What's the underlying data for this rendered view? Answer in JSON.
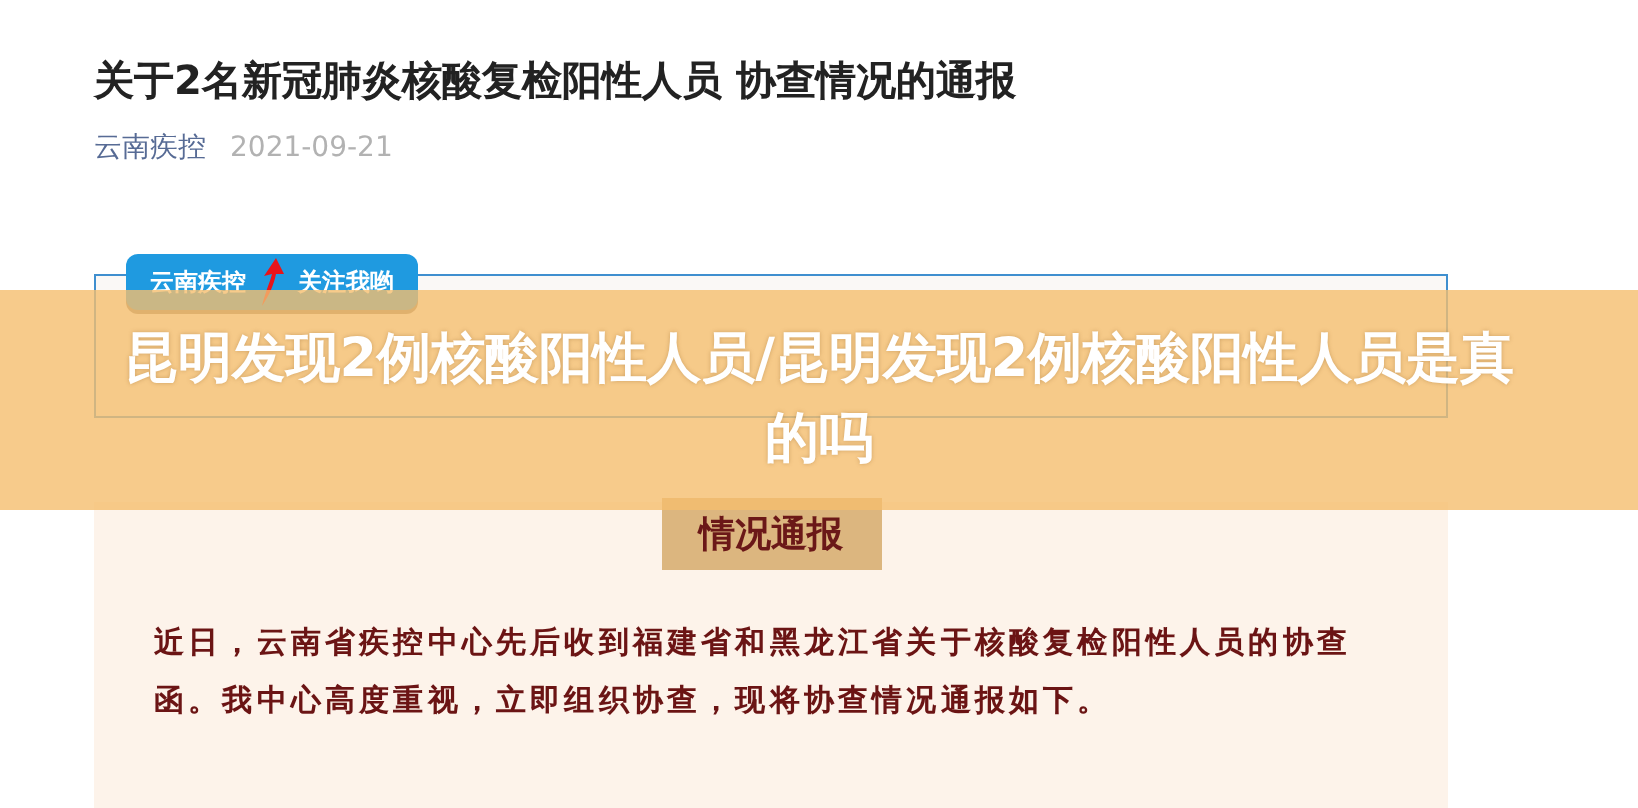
{
  "article": {
    "title": "关于2名新冠肺炎核酸复检阳性人员 协查情况的通报",
    "source": "云南疾控",
    "date": "2021-09-21"
  },
  "badge": {
    "account": "云南疾控",
    "follow": "关注我哟"
  },
  "section": {
    "tab": "情况通报",
    "paragraph": "近日，云南省疾控中心先后收到福建省和黑龙江省关于核酸复检阳性人员的协查函。我中心高度重视，立即组织协查，现将协查情况通报如下。"
  },
  "overlay": {
    "title": "昆明发现2例核酸阳性人员/昆明发现2例核酸阳性人员是真的吗"
  }
}
